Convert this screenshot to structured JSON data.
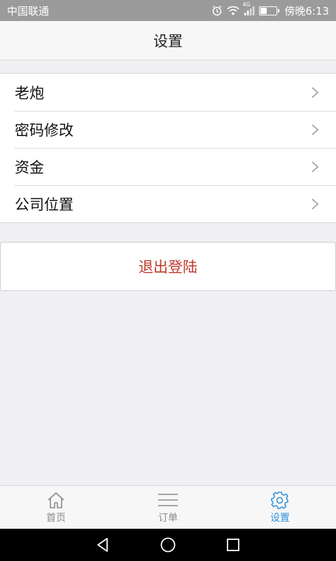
{
  "status_bar": {
    "carrier": "中国联通",
    "network": "4G",
    "time": "傍晚6:13"
  },
  "header": {
    "title": "设置"
  },
  "settings": {
    "items": [
      {
        "label": "老炮"
      },
      {
        "label": "密码修改"
      },
      {
        "label": "资金"
      },
      {
        "label": "公司位置"
      }
    ]
  },
  "logout": {
    "label": "退出登陆"
  },
  "tabs": [
    {
      "label": "首页",
      "icon": "home-icon",
      "active": false
    },
    {
      "label": "订单",
      "icon": "list-icon",
      "active": false
    },
    {
      "label": "设置",
      "icon": "gear-icon",
      "active": true
    }
  ],
  "colors": {
    "accent": "#2f8fdc",
    "logout_text": "#c0392b",
    "background": "#efeff4"
  }
}
